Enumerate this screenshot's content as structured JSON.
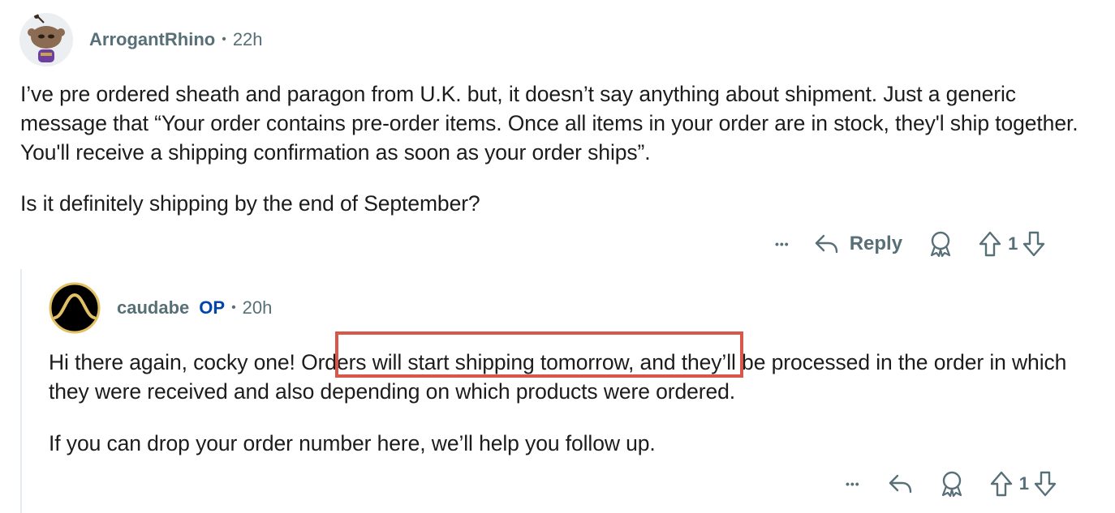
{
  "comment1": {
    "author": "ArrogantRhino",
    "separator": "•",
    "time": "22h",
    "paragraphs": [
      "I’ve pre ordered sheath and paragon from U.K. but, it doesn’t say anything about shipment. Just a generic message that “Your order contains pre-order items. Once all items in your order are in stock, they'l ship together. You'll receive a shipping confirmation as soon as your order ships”.",
      "Is it definitely shipping by the end of September?"
    ],
    "actions": {
      "more": "•••",
      "reply": "Reply",
      "votes": "1"
    }
  },
  "comment2": {
    "author": "caudabe",
    "badge": "OP",
    "separator": "•",
    "time": "20h",
    "p1_before": "Hi there again, cocky one! ",
    "p1_highlight": "Orders will start shipping tomorrow,",
    "p1_after": " and they’ll be processed in the order in which they were received and also depending on which products were ordered.",
    "p2": "If you can drop your order number here, we’ll help you follow up.",
    "actions": {
      "more": "•••",
      "votes": "1"
    }
  },
  "colors": {
    "meta": "#576f76",
    "op": "#0045ac",
    "highlight": "#d9574a"
  }
}
